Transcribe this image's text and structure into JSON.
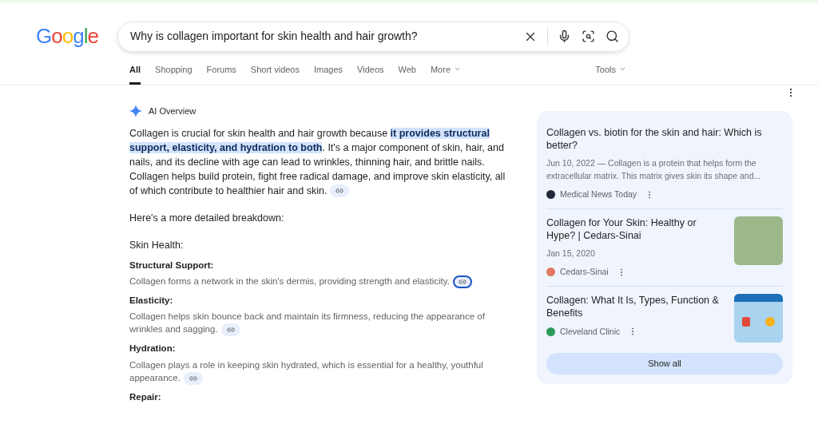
{
  "logo": "Google",
  "search": {
    "value": "Why is collagen important for skin health and hair growth?"
  },
  "tabs": [
    {
      "label": "All",
      "selected": true,
      "dropdown": false
    },
    {
      "label": "Shopping",
      "selected": false,
      "dropdown": false
    },
    {
      "label": "Forums",
      "selected": false,
      "dropdown": false
    },
    {
      "label": "Short videos",
      "selected": false,
      "dropdown": false
    },
    {
      "label": "Images",
      "selected": false,
      "dropdown": false
    },
    {
      "label": "Videos",
      "selected": false,
      "dropdown": false
    },
    {
      "label": "Web",
      "selected": false,
      "dropdown": false
    },
    {
      "label": "More",
      "selected": false,
      "dropdown": true
    }
  ],
  "tools": "Tools",
  "overview": {
    "title": "AI Overview",
    "intro": [
      {
        "text": "Collagen is crucial for skin health and hair growth because ",
        "highlighted": false
      },
      {
        "text": "it provides structural support, elasticity, and hydration to both",
        "highlighted": true
      },
      {
        "text": ". It's a major component of skin, hair, and nails, and its decline with age can lead to wrinkles, thinning hair, and brittle nails. Collagen helps build protein, fight free radical damage, and improve skin elasticity, all of which contribute to healthier hair and skin.",
        "highlighted": false
      }
    ],
    "intro_link_focused": false,
    "lead": "Here's a more detailed breakdown:",
    "section": "Skin Health:",
    "points": [
      {
        "title": "Structural Support:",
        "text": "Collagen forms a network in the skin's dermis, providing strength and elasticity.",
        "focused": true
      },
      {
        "title": "Elasticity:",
        "text": "Collagen helps skin bounce back and maintain its firmness, reducing the appearance of wrinkles and sagging.",
        "focused": false
      },
      {
        "title": "Hydration:",
        "text": "Collagen plays a role in keeping skin hydrated, which is essential for a healthy, youthful appearance.",
        "focused": false
      },
      {
        "title": "Repair:"
      }
    ]
  },
  "sources": [
    {
      "kind": "text",
      "title": "Collagen vs. biotin for the skin and hair: Which is better?",
      "snippet": "Jun 10, 2022 — Collagen is a protein that helps form the extracellular matrix. This matrix gives skin its shape and...",
      "site": "Medical News Today",
      "color": "#1f2937"
    },
    {
      "kind": "photo",
      "title": "Collagen for Your Skin: Healthy or Hype? | Cedars-Sinai",
      "snippet": "Jan 15, 2020",
      "site": "Cedars-Sinai",
      "color": "#e07a5f"
    },
    {
      "kind": "infographic",
      "title": "Collagen: What It Is, Types, Function & Benefits",
      "site": "Cleveland Clinic",
      "color": "#2e9a5a"
    }
  ],
  "show_all": "Show all"
}
